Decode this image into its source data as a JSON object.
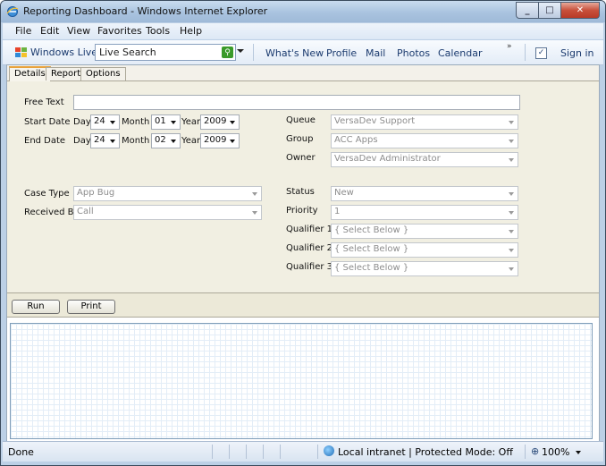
{
  "window": {
    "title": "Reporting Dashboard - Windows Internet Explorer"
  },
  "menu": [
    "File",
    "Edit",
    "View",
    "Favorites",
    "Tools",
    "Help"
  ],
  "livebar": {
    "brand": "Windows Live",
    "search_placeholder": "Live Search",
    "links": [
      "What's New",
      "Profile",
      "Mail",
      "Photos",
      "Calendar"
    ],
    "more": "»",
    "sign_in": "Sign in"
  },
  "tabs": [
    {
      "label": "Details",
      "active": true
    },
    {
      "label": "Report",
      "active": false
    },
    {
      "label": "Options",
      "active": false
    }
  ],
  "form": {
    "free_text_label": "Free Text",
    "free_text_value": "",
    "start_date_label": "Start Date",
    "end_date_label": "End Date",
    "day_label": "Day",
    "month_label": "Month",
    "year_label": "Year",
    "start_day": "24",
    "start_month": "01",
    "start_year": "2009",
    "end_day": "24",
    "end_month": "02",
    "end_year": "2009",
    "queue_label": "Queue",
    "queue_value": "VersaDev Support",
    "group_label": "Group",
    "group_value": "ACC Apps",
    "owner_label": "Owner",
    "owner_value": "VersaDev Administrator",
    "case_type_label": "Case Type",
    "case_type_value": "App Bug",
    "received_by_label": "Received By",
    "received_by_value": "Call",
    "status_label": "Status",
    "status_value": "New",
    "priority_label": "Priority",
    "priority_value": "1",
    "qualifier1_label": "Qualifier 1",
    "qualifier1_value": "{ Select Below }",
    "qualifier2_label": "Qualifier 2",
    "qualifier2_value": "{ Select Below }",
    "qualifier3_label": "Qualifier 3",
    "qualifier3_value": "{ Select Below }"
  },
  "buttons": {
    "run": "Run",
    "print": "Print"
  },
  "status": {
    "text": "Done",
    "zone": "Local intranet | Protected Mode: Off",
    "zoom": "100%"
  }
}
